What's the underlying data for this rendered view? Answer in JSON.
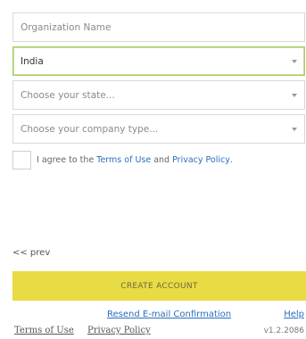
{
  "form": {
    "organization_placeholder": "Organization Name",
    "country_value": "India",
    "state_placeholder": "Choose your state...",
    "company_type_placeholder": "Choose your company type..."
  },
  "agreement": {
    "prefix": "I agree to the",
    "terms_link": "Terms of Use",
    "and_text": "and",
    "privacy_link": "Privacy Policy",
    "suffix": "."
  },
  "navigation": {
    "prev_label": "<< prev"
  },
  "actions": {
    "create_label": "CREATE ACCOUNT"
  },
  "footer": {
    "resend_label": "Resend E-mail Confirmation",
    "help_label": "Help",
    "terms_label": "Terms of Use",
    "privacy_label": "Privacy Policy",
    "version": "v1.2.2086"
  },
  "colors": {
    "primary_button": "#e9db43",
    "active_border": "#a8cc64",
    "link": "#2a6ebd"
  }
}
